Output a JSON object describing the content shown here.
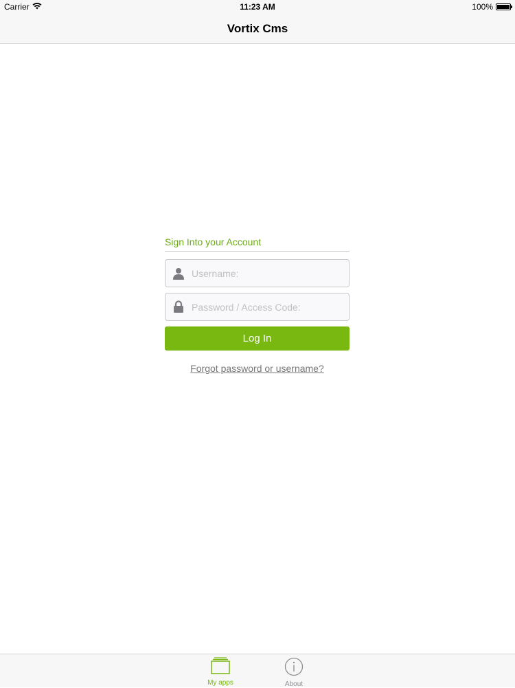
{
  "status_bar": {
    "carrier": "Carrier",
    "time": "11:23 AM",
    "battery": "100%",
    "battery_level": 1.0
  },
  "nav": {
    "title": "Vortix Cms"
  },
  "login": {
    "heading": "Sign Into your Account",
    "username_placeholder": "Username:",
    "username_value": "",
    "password_placeholder": "Password / Access Code:",
    "password_value": "",
    "login_label": "Log In",
    "forgot_label": "Forgot password or username?"
  },
  "tabs": [
    {
      "label": "My apps",
      "icon": "folder-icon",
      "active": true
    },
    {
      "label": "About",
      "icon": "info-icon",
      "active": false
    }
  ],
  "colors": {
    "accent": "#78b811",
    "heading": "#6aab11",
    "inactive_tab": "#8e8e93"
  }
}
